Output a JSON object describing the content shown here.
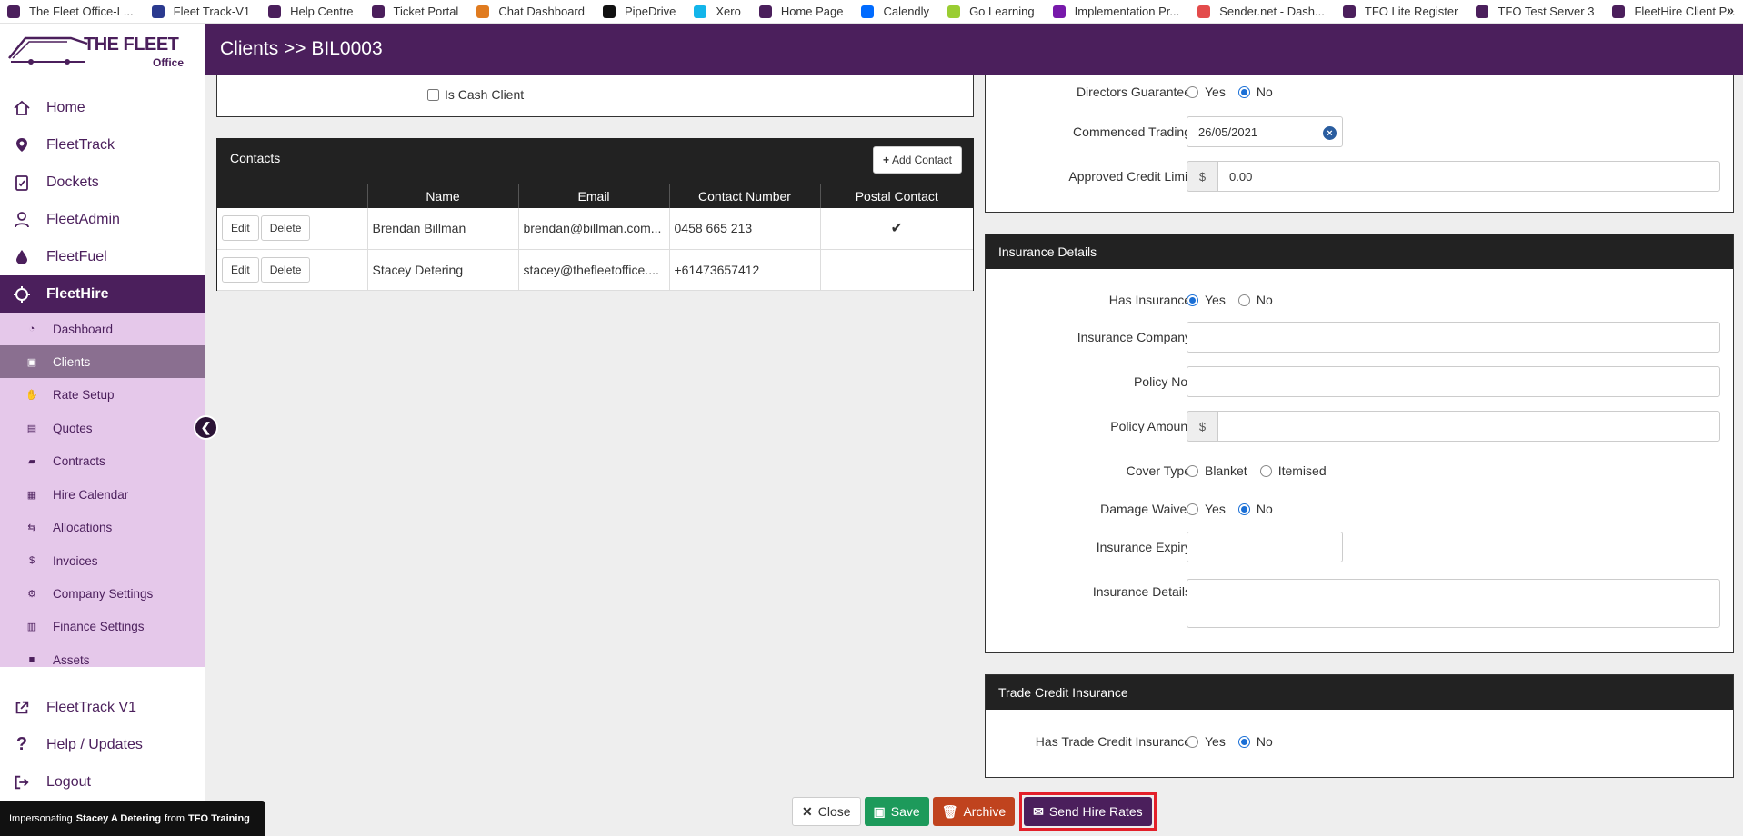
{
  "bookmarks": [
    {
      "label": "The Fleet Office-L...",
      "color": "#4b1f5c"
    },
    {
      "label": "Fleet Track-V1",
      "color": "#2b3a8f"
    },
    {
      "label": "Help Centre",
      "color": "#4b1f5c"
    },
    {
      "label": "Ticket Portal",
      "color": "#4b1f5c"
    },
    {
      "label": "Chat Dashboard",
      "color": "#e07b1f"
    },
    {
      "label": "PipeDrive",
      "color": "#111111"
    },
    {
      "label": "Xero",
      "color": "#13b5ea"
    },
    {
      "label": "Home Page",
      "color": "#4b1f5c"
    },
    {
      "label": "Calendly",
      "color": "#006bff"
    },
    {
      "label": "Go Learning",
      "color": "#9acd32"
    },
    {
      "label": "Implementation Pr...",
      "color": "#7719aa"
    },
    {
      "label": "Sender.net - Dash...",
      "color": "#e34b4b"
    },
    {
      "label": "TFO Lite Register",
      "color": "#4b1f5c"
    },
    {
      "label": "TFO Test Server 3",
      "color": "#4b1f5c"
    },
    {
      "label": "FleetHire Client P...",
      "color": "#4b1f5c"
    }
  ],
  "more_bookmarks": "»",
  "logo": {
    "main": "THE FLEET",
    "sub": "Office"
  },
  "page_title": "Clients >> BIL0003",
  "nav": [
    {
      "label": "Home",
      "icon": "home-icon"
    },
    {
      "label": "FleetTrack",
      "icon": "location-pin-icon"
    },
    {
      "label": "Dockets",
      "icon": "clipboard-check-icon"
    },
    {
      "label": "FleetAdmin",
      "icon": "user-admin-icon"
    },
    {
      "label": "FleetFuel",
      "icon": "fuel-drop-icon"
    },
    {
      "label": "FleetHire",
      "icon": "hire-cycle-icon"
    }
  ],
  "submenu": [
    {
      "label": "Dashboard",
      "icon": "◔"
    },
    {
      "label": "Clients",
      "icon": "▣"
    },
    {
      "label": "Rate Setup",
      "icon": "✋"
    },
    {
      "label": "Quotes",
      "icon": "▤"
    },
    {
      "label": "Contracts",
      "icon": "▰"
    },
    {
      "label": "Hire Calendar",
      "icon": "▦"
    },
    {
      "label": "Allocations",
      "icon": "⇆"
    },
    {
      "label": "Invoices",
      "icon": "$"
    },
    {
      "label": "Company Settings",
      "icon": "⚙"
    },
    {
      "label": "Finance Settings",
      "icon": "▥"
    },
    {
      "label": "Assets",
      "icon": "■"
    }
  ],
  "nav_bottom": [
    {
      "label": "FleetTrack V1",
      "icon": "external-link-icon"
    },
    {
      "label": "Help / Updates",
      "icon": "question-icon"
    },
    {
      "label": "Logout",
      "icon": "logout-icon"
    }
  ],
  "impersonate": {
    "prefix": "Impersonating",
    "user": "Stacey A Detering",
    "mid": "from",
    "org": "TFO Training"
  },
  "cash_client": {
    "label": "Is Cash Client",
    "checked": false
  },
  "contacts": {
    "title": "Contacts",
    "add_label": "Add Contact",
    "columns": [
      "",
      "Name",
      "Email",
      "Contact Number",
      "Postal Contact"
    ],
    "edit_label": "Edit",
    "delete_label": "Delete",
    "rows": [
      {
        "name": "Brendan Billman",
        "email": "brendan@billman.com...",
        "phone": "0458 665 213",
        "postal": "✔"
      },
      {
        "name": "Stacey Detering",
        "email": "stacey@thefleetoffice....",
        "phone": "+61473657412",
        "postal": ""
      }
    ]
  },
  "company": {
    "directors_guarantee": {
      "label": "Directors Guarantee",
      "yes": "Yes",
      "no": "No",
      "value": "No"
    },
    "commenced_trading": {
      "label": "Commenced Trading",
      "value": "26/05/2021"
    },
    "credit_limit": {
      "label": "Approved Credit Limit",
      "currency": "$",
      "value": "0.00"
    }
  },
  "insurance": {
    "title": "Insurance Details",
    "has_insurance": {
      "label": "Has Insurance",
      "yes": "Yes",
      "no": "No",
      "value": "Yes"
    },
    "company": {
      "label": "Insurance Company",
      "value": ""
    },
    "policy_no": {
      "label": "Policy No.",
      "value": ""
    },
    "policy_amount": {
      "label": "Policy Amount",
      "currency": "$",
      "value": ""
    },
    "cover_type": {
      "label": "Cover Type",
      "opt1": "Blanket",
      "opt2": "Itemised",
      "value": ""
    },
    "damage_waiver": {
      "label": "Damage Waiver",
      "yes": "Yes",
      "no": "No",
      "value": "No"
    },
    "expiry": {
      "label": "Insurance Expiry",
      "value": ""
    },
    "details": {
      "label": "Insurance Details",
      "value": ""
    }
  },
  "trade_credit": {
    "title": "Trade Credit Insurance",
    "has": {
      "label": "Has Trade Credit Insurance",
      "yes": "Yes",
      "no": "No",
      "value": "No"
    }
  },
  "footer": {
    "close": "Close",
    "save": "Save",
    "archive": "Archive",
    "send": "Send Hire Rates"
  }
}
